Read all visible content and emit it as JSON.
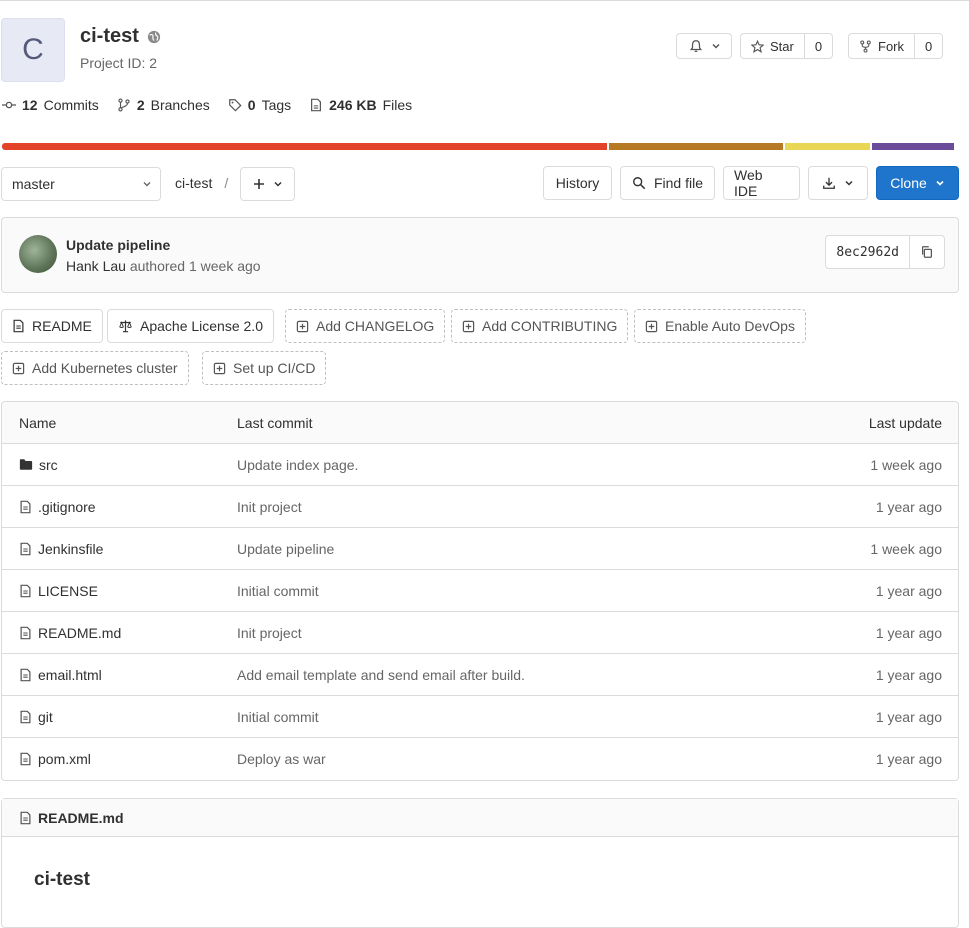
{
  "project": {
    "avatar_letter": "C",
    "name": "ci-test",
    "id_text": "Project ID: 2"
  },
  "header_actions": {
    "star_label": "Star",
    "star_count": "0",
    "fork_label": "Fork",
    "fork_count": "0"
  },
  "stats": {
    "commits_count": "12",
    "commits_label": "Commits",
    "branches_count": "2",
    "branches_label": "Branches",
    "tags_count": "0",
    "tags_label": "Tags",
    "files_size": "246 KB",
    "files_label": "Files"
  },
  "language_bar": {
    "segments": [
      {
        "color": "#e24329",
        "fraction": 0.636
      },
      {
        "color": "#b57a23",
        "fraction": 0.183
      },
      {
        "color": "#e8d654",
        "fraction": 0.089
      },
      {
        "color": "#6b4c9a",
        "fraction": 0.087
      }
    ]
  },
  "tree": {
    "branch": "master",
    "path": "ci-test",
    "path_sep": "/",
    "history_label": "History",
    "find_file_label": "Find file",
    "web_ide_label": "Web IDE",
    "clone_label": "Clone"
  },
  "last_commit": {
    "title": "Update pipeline",
    "author": "Hank Lau",
    "authored_text": "authored 1 week ago",
    "sha": "8ec2962d"
  },
  "quick_actions": {
    "readme": "README",
    "license": "Apache License 2.0",
    "add_changelog": "Add CHANGELOG",
    "add_contributing": "Add CONTRIBUTING",
    "auto_devops": "Enable Auto DevOps",
    "add_k8s": "Add Kubernetes cluster",
    "setup_cicd": "Set up CI/CD"
  },
  "files": {
    "columns": [
      "Name",
      "Last commit",
      "Last update"
    ],
    "rows": [
      {
        "name": "src",
        "type": "folder",
        "commit": "Update index page.",
        "updated": "1 week ago"
      },
      {
        "name": ".gitignore",
        "type": "file",
        "commit": "Init project",
        "updated": "1 year ago"
      },
      {
        "name": "Jenkinsfile",
        "type": "file",
        "commit": "Update pipeline",
        "updated": "1 week ago"
      },
      {
        "name": "LICENSE",
        "type": "file",
        "commit": "Initial commit",
        "updated": "1 year ago"
      },
      {
        "name": "README.md",
        "type": "file",
        "commit": "Init project",
        "updated": "1 year ago"
      },
      {
        "name": "email.html",
        "type": "file",
        "commit": "Add email template and send email after build.",
        "updated": "1 year ago"
      },
      {
        "name": "git",
        "type": "file",
        "commit": "Initial commit",
        "updated": "1 year ago"
      },
      {
        "name": "pom.xml",
        "type": "file",
        "commit": "Deploy as war",
        "updated": "1 year ago"
      }
    ]
  },
  "readme": {
    "filename": "README.md",
    "heading": "ci-test"
  }
}
